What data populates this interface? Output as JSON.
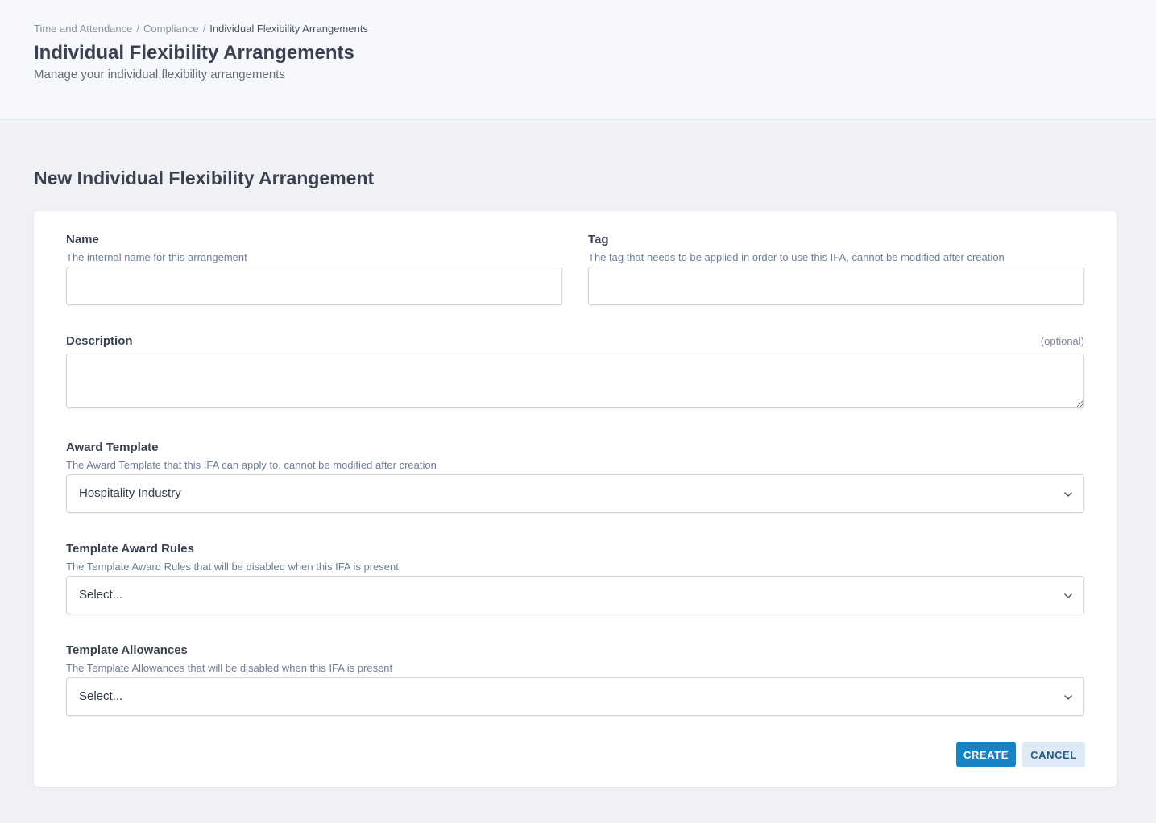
{
  "breadcrumb": {
    "items": [
      "Time and Attendance",
      "Compliance"
    ],
    "current": "Individual Flexibility Arrangements",
    "separator": "/"
  },
  "page": {
    "title": "Individual Flexibility Arrangements",
    "subtitle": "Manage your individual flexibility arrangements"
  },
  "form": {
    "title": "New Individual Flexibility Arrangement",
    "name": {
      "label": "Name",
      "help": "The internal name for this arrangement",
      "value": ""
    },
    "tag": {
      "label": "Tag",
      "help": "The tag that needs to be applied in order to use this IFA, cannot be modified after creation",
      "value": ""
    },
    "description": {
      "label": "Description",
      "optional": "(optional)",
      "value": ""
    },
    "award_template": {
      "label": "Award Template",
      "help": "The Award Template that this IFA can apply to, cannot be modified after creation",
      "value": "Hospitality Industry"
    },
    "template_award_rules": {
      "label": "Template Award Rules",
      "help": "The Template Award Rules that will be disabled when this IFA is present",
      "value": "Select..."
    },
    "template_allowances": {
      "label": "Template Allowances",
      "help": "The Template Allowances that will be disabled when this IFA is present",
      "value": "Select..."
    },
    "buttons": {
      "create": "CREATE",
      "cancel": "CANCEL"
    }
  },
  "colors": {
    "primary": "#1782c4",
    "secondary_bg": "#deebf6",
    "help_text": "#6f7d96"
  },
  "icons": {
    "dropdown": "chevron-down-icon"
  }
}
